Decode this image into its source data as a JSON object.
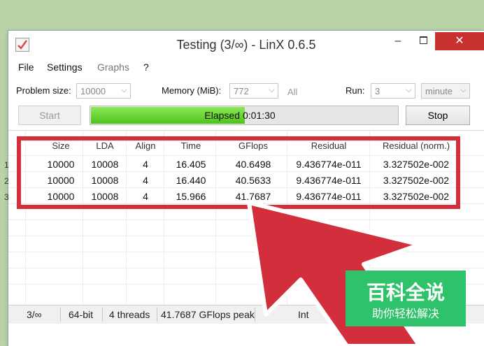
{
  "window": {
    "title": "Testing (3/∞) - LinX 0.6.5",
    "minimize": "–",
    "close": "✕"
  },
  "menu": [
    "File",
    "Settings",
    "Graphs",
    "?"
  ],
  "controls": {
    "problem_size_label": "Problem size:",
    "problem_size_value": "10000",
    "memory_label": "Memory (MiB):",
    "memory_value": "772",
    "all_label": "All",
    "run_label": "Run:",
    "run_value": "3",
    "run_unit": "minute",
    "start_label": "Start",
    "stop_label": "Stop",
    "progress_label": "Elapsed",
    "progress_time": "0:01:30",
    "progress_fraction": 0.5
  },
  "table": {
    "headers": [
      "Size",
      "LDA",
      "Align",
      "Time",
      "GFlops",
      "Residual",
      "Residual (norm.)"
    ],
    "rows": [
      {
        "num": "1",
        "cells": [
          "10000",
          "10008",
          "4",
          "16.405",
          "40.6498",
          "9.436774e-011",
          "3.327502e-002"
        ]
      },
      {
        "num": "2",
        "cells": [
          "10000",
          "10008",
          "4",
          "16.440",
          "40.5633",
          "9.436774e-011",
          "3.327502e-002"
        ]
      },
      {
        "num": "3",
        "cells": [
          "10000",
          "10008",
          "4",
          "15.966",
          "41.7687",
          "9.436774e-011",
          "3.327502e-002"
        ]
      }
    ]
  },
  "status": {
    "runs": "3/∞",
    "bits": "64-bit",
    "threads": "4 threads",
    "peak": "41.7687 GFlops peak",
    "cpu": "Int"
  },
  "watermark": {
    "title": "百科全说",
    "subtitle": "助你轻松解决"
  },
  "colors": {
    "highlight": "#d22e3c",
    "progress": "#5fd02c",
    "watermark_bg": "#2ec26a",
    "close_button": "#c7312e"
  }
}
